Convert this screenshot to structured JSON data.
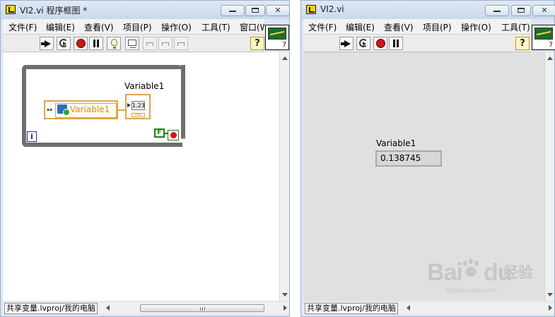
{
  "left_window": {
    "title": "VI2.vi 程序框图 *",
    "menus": [
      "文件(F)",
      "编辑(E)",
      "查看(V)",
      "项目(P)",
      "操作(O)",
      "工具(T)",
      "窗口(W)"
    ],
    "status_path": "共享变量.lvproj/我的电脑",
    "icon_number": "7"
  },
  "right_window": {
    "title": "VI2.vi",
    "menus": [
      "文件(F)",
      "编辑(E)",
      "查看(V)",
      "项目(P)",
      "操作(O)",
      "工具(T)"
    ],
    "status_path": "共享变量.lvproj/我的电脑",
    "icon_number": "7"
  },
  "help_label": "?",
  "block_diagram": {
    "shared_variable_label": "Variable1",
    "indicator_label": "Variable1",
    "indicator_numeric": "1.23",
    "indicator_type": "DBL",
    "iteration_label": "i",
    "false_constant": "F"
  },
  "front_panel": {
    "indicator_label": "Variable1",
    "indicator_value": "0.138745"
  },
  "watermark": {
    "brand_left": "Bai",
    "brand_right": "du",
    "brand_cn": "经验",
    "url": "jingyan.baidu.com"
  },
  "colors": {
    "wire_orange": "#e2a34a",
    "loop_gray": "#6e6e6e",
    "boolean_green": "#1b7e1b",
    "stop_red": "#d21616"
  }
}
